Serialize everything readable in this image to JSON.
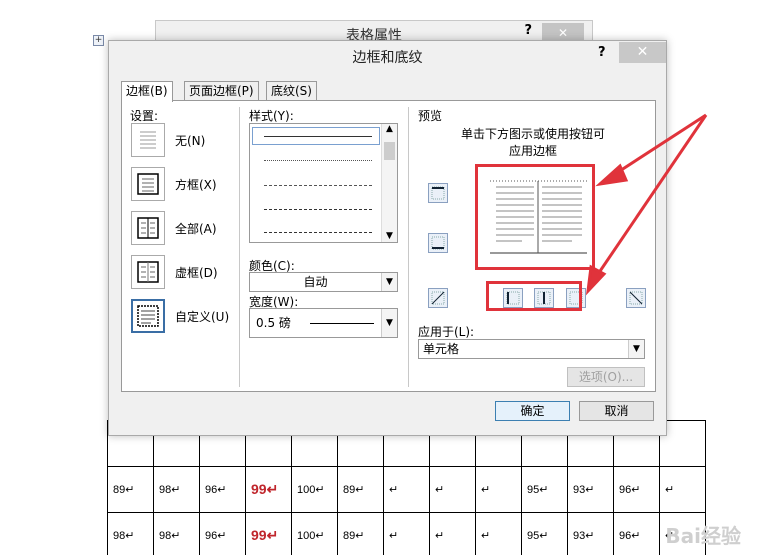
{
  "background_dialog": {
    "title": "表格属性",
    "help": "?",
    "close": "✕"
  },
  "dialog": {
    "title": "边框和底纹",
    "help": "?",
    "close": "✕",
    "tabs": [
      {
        "label": "边框(B)"
      },
      {
        "label": "页面边框(P)"
      },
      {
        "label": "底纹(S)"
      }
    ],
    "settings": {
      "label": "设置:",
      "items": [
        {
          "label": "无(N)"
        },
        {
          "label": "方框(X)"
        },
        {
          "label": "全部(A)"
        },
        {
          "label": "虚框(D)"
        },
        {
          "label": "自定义(U)"
        }
      ]
    },
    "style": {
      "label": "样式(Y):"
    },
    "color": {
      "label": "颜色(C):",
      "value": "自动"
    },
    "width": {
      "label": "宽度(W):",
      "value": "0.5 磅"
    },
    "preview": {
      "label": "预览",
      "hint_line1": "单击下方图示或使用按钮可",
      "hint_line2": "应用边框"
    },
    "apply_to": {
      "label": "应用于(L):",
      "value": "单元格"
    },
    "options_button": "选项(O)...",
    "ok_button": "确定",
    "cancel_button": "取消"
  },
  "table": {
    "rows": [
      [
        "89↵",
        "98↵",
        "96↵",
        "99↵",
        "100↵",
        "89↵",
        "↵",
        "↵",
        "↵",
        "95↵",
        "93↵",
        "96↵",
        "↵"
      ],
      [
        "98↵",
        "98↵",
        "96↵",
        "99↵",
        "100↵",
        "89↵",
        "↵",
        "↵",
        "↵",
        "95↵",
        "93↵",
        "96↵",
        "↵"
      ]
    ]
  },
  "watermark": "Bai经验",
  "colors": {
    "highlight_red": "#e0333b",
    "value_red": "#c0262c",
    "dialog_bg": "#f0f0f0"
  }
}
